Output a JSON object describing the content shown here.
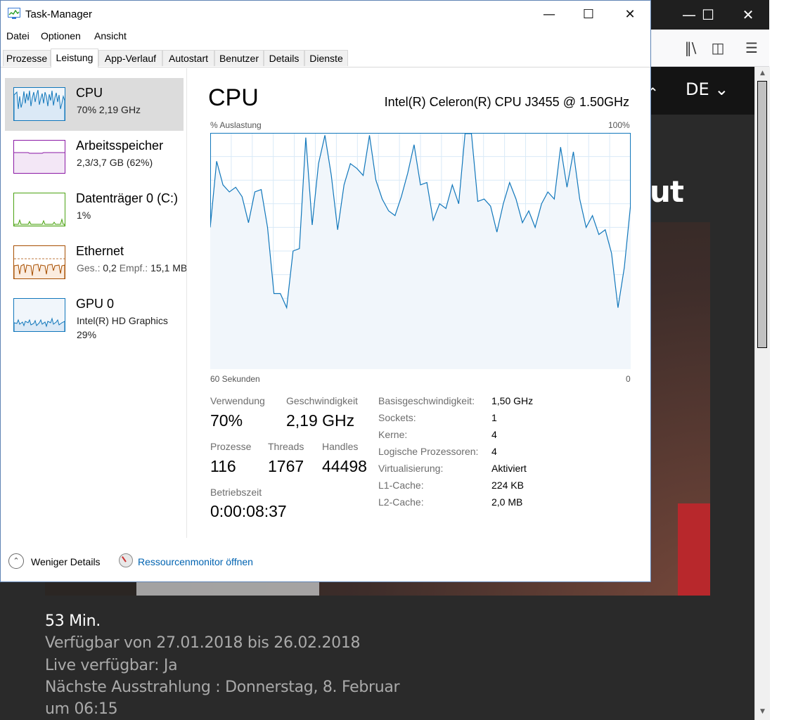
{
  "browser": {
    "language": "DE",
    "headline_partial": "ut",
    "info_lines": [
      "53 Min.",
      "Verfügbar von 27.01.2018 bis 26.02.2018",
      "Live verfügbar: Ja",
      "Nächste Ausstrahlung : Donnerstag, 8. Februar",
      "um 06:15"
    ]
  },
  "taskmanager": {
    "title": "Task-Manager",
    "menu": [
      "Datei",
      "Optionen",
      "Ansicht"
    ],
    "tabs": [
      "Prozesse",
      "Leistung",
      "App-Verlauf",
      "Autostart",
      "Benutzer",
      "Details",
      "Dienste"
    ],
    "active_tab": "Leistung",
    "sidebar": [
      {
        "name": "CPU",
        "sub": "70% 2,19 GHz",
        "color": "#1177bb"
      },
      {
        "name": "Arbeitsspeicher",
        "sub": "2,3/3,7 GB (62%)",
        "color": "#8b19a5"
      },
      {
        "name": "Datenträger 0 (C:)",
        "sub": "1%",
        "color": "#4ca313"
      },
      {
        "name": "Ethernet",
        "send_label": "Ges.:",
        "send_value": "0,2",
        "recv_label": "Empf.:",
        "recv_value": "15,1 MB",
        "color": "#a74f01"
      },
      {
        "name": "GPU 0",
        "sub": "Intel(R) HD Graphics",
        "sub2": "29%",
        "color": "#1177bb"
      }
    ],
    "main": {
      "title": "CPU",
      "model": "Intel(R) Celeron(R) CPU J3455 @ 1.50GHz",
      "y_label": "% Auslastung",
      "y_max_label": "100%",
      "x_left_label": "60 Sekunden",
      "x_right_label": "0",
      "stats": {
        "usage_label": "Verwendung",
        "usage": "70%",
        "speed_label": "Geschwindigkeit",
        "speed": "2,19 GHz",
        "processes_label": "Prozesse",
        "processes": "116",
        "threads_label": "Threads",
        "threads": "1767",
        "handles_label": "Handles",
        "handles": "44498",
        "uptime_label": "Betriebszeit",
        "uptime": "0:00:08:37"
      },
      "details": [
        {
          "k": "Basisgeschwindigkeit:",
          "v": "1,50 GHz"
        },
        {
          "k": "Sockets:",
          "v": "1"
        },
        {
          "k": "Kerne:",
          "v": "4"
        },
        {
          "k": "Logische Prozessoren:",
          "v": "4"
        },
        {
          "k": "Virtualisierung:",
          "v": "Aktiviert"
        },
        {
          "k": "L1-Cache:",
          "v": "224 KB"
        },
        {
          "k": "L2-Cache:",
          "v": "2,0 MB"
        }
      ]
    },
    "footer": {
      "less_details": "Weniger Details",
      "resource_monitor": "Ressourcenmonitor öffnen"
    }
  },
  "chart_data": {
    "type": "area",
    "y_range": [
      0,
      100
    ],
    "x_range_seconds": [
      60,
      0
    ],
    "color": "#1177bb",
    "values": [
      60,
      88,
      78,
      75,
      77,
      73,
      62,
      75,
      76,
      60,
      32,
      32,
      26,
      50,
      51,
      98,
      61,
      87,
      99,
      82,
      59,
      78,
      87,
      85,
      82,
      99,
      80,
      72,
      67,
      65,
      73,
      83,
      95,
      78,
      79,
      63,
      70,
      68,
      78,
      70,
      100,
      100,
      71,
      72,
      69,
      58,
      70,
      79,
      72,
      62,
      67,
      60,
      70,
      75,
      72,
      94,
      77,
      92,
      72,
      60,
      65,
      57,
      59,
      49,
      26,
      43,
      70
    ]
  }
}
